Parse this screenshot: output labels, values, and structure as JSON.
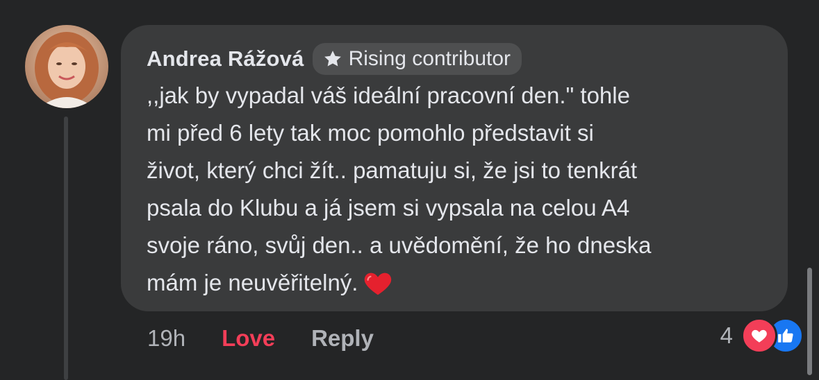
{
  "comment": {
    "author": "Andrea Rážová",
    "badge": {
      "icon": "star-icon",
      "label": "Rising contributor"
    },
    "text": ",,jak by vypadal váš ideální pracovní den.\" tohle\nmi před 6 lety tak moc pomohlo představit si\nživot, který chci žít.. pamatuju si, že jsi to tenkrát\npsala do Klubu a já jsem si vypsala na celou A4\nsvoje ráno, svůj den.. a uvědomění, že ho dneska\nmám je neuvěřitelný.",
    "trailing_emoji": "red-heart-emoji"
  },
  "actions": {
    "time": "19h",
    "love_label": "Love",
    "reply_label": "Reply"
  },
  "reactions": {
    "count": "4",
    "icons": [
      "love-reaction-icon",
      "like-reaction-icon"
    ]
  },
  "colors": {
    "background": "#242526",
    "bubble": "#3a3b3c",
    "love": "#f33e58",
    "like": "#1877f2",
    "text": "#e4e6eb",
    "muted": "#b0b3b8"
  }
}
